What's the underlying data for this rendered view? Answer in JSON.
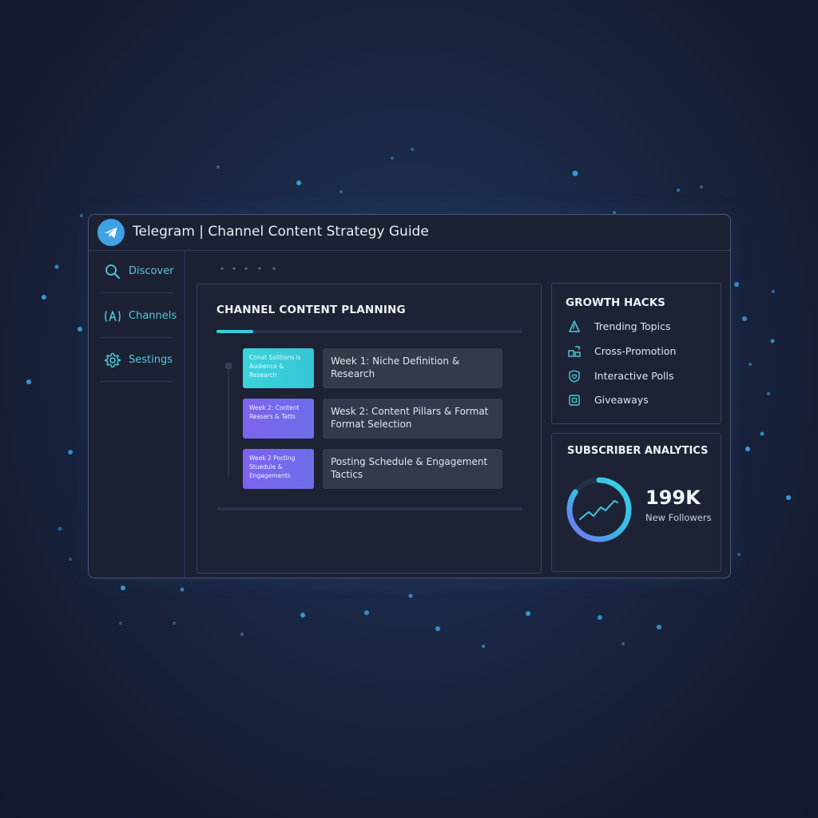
{
  "window": {
    "title": "Telegram | Channel Content Strategy Guide",
    "logo_icon": "telegram-paper-plane-icon"
  },
  "sidebar": {
    "items": [
      {
        "label": "Discover",
        "icon": "search-icon"
      },
      {
        "label": "Channels",
        "icon": "broadcast-icon"
      },
      {
        "label": "Sestings",
        "icon": "gear-icon"
      }
    ]
  },
  "planning": {
    "title": "CHANNEL CONTENT PLANNING",
    "progress": 0.12,
    "weeks": [
      {
        "tag": "Conat Solitions is Audience & Research",
        "card": "Week 1: Niche Definition & Research",
        "tag_color": "#38cfd8"
      },
      {
        "tag": "Week 2: Content Reasers & Tatts",
        "card": "Wesk 2: Content Pillars & Format Format Selection",
        "tag_color": "#7766ec"
      },
      {
        "tag": "Week 2 Posting Stuedule & Engagements",
        "card": "Posting Schedule & Engagement Tactics",
        "tag_color": "#7766ec"
      }
    ]
  },
  "growth": {
    "title": "GROWTH HACKS",
    "items": [
      {
        "label": "Trending Topics",
        "icon": "trending-triangle-icon"
      },
      {
        "label": "Cross-Promotion",
        "icon": "share-blocks-icon"
      },
      {
        "label": "Interactive Polls",
        "icon": "heart-badge-icon"
      },
      {
        "label": "Giveaways",
        "icon": "gift-box-icon"
      }
    ]
  },
  "analytics": {
    "title": "SUBSCRIBER ANALYTICS",
    "value": "199K",
    "label": "New Followers",
    "ring_fill": 0.85
  },
  "colors": {
    "accent_teal": "#36d0d8",
    "accent_purple": "#7766ec",
    "window_bg": "#1c2234",
    "page_bg": "#1b2846"
  }
}
